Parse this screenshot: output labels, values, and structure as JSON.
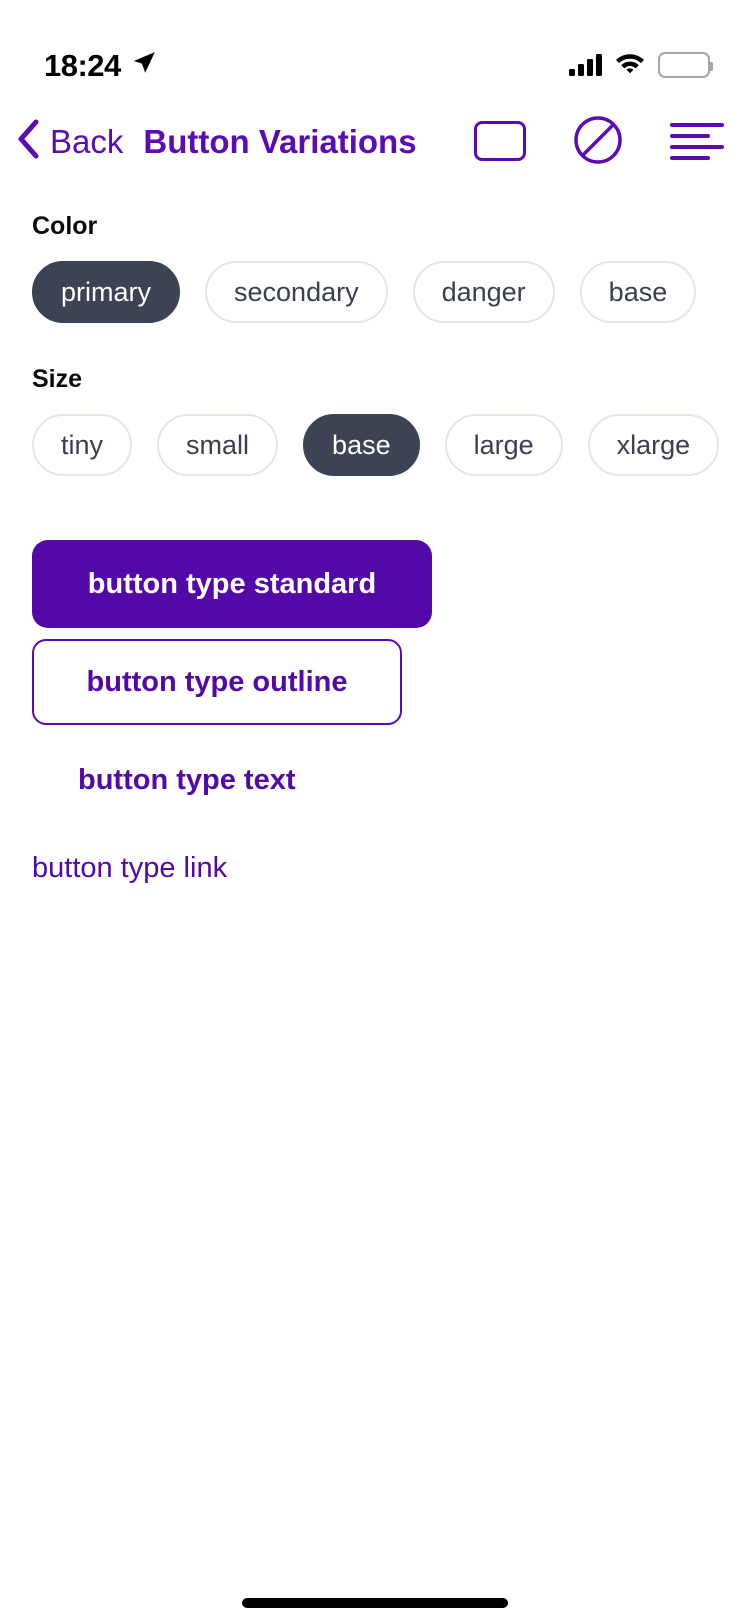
{
  "status_bar": {
    "time": "18:24",
    "location_icon": "location-arrow-icon",
    "signal_icon": "cellular-signal-icon",
    "wifi_icon": "wifi-icon",
    "battery_icon": "battery-full-icon"
  },
  "nav_bar": {
    "back_label": "Back",
    "back_icon": "chevron-left-icon",
    "title": "Button Variations",
    "actions": [
      {
        "name": "rounded-square-icon"
      },
      {
        "name": "prohibited-circle-slash-icon"
      },
      {
        "name": "list-lines-icon"
      }
    ]
  },
  "sections": {
    "color": {
      "label": "Color",
      "options": [
        {
          "label": "primary",
          "selected": true
        },
        {
          "label": "secondary",
          "selected": false
        },
        {
          "label": "danger",
          "selected": false
        },
        {
          "label": "base",
          "selected": false
        }
      ]
    },
    "size": {
      "label": "Size",
      "options": [
        {
          "label": "tiny",
          "selected": false
        },
        {
          "label": "small",
          "selected": false
        },
        {
          "label": "base",
          "selected": true
        },
        {
          "label": "large",
          "selected": false
        },
        {
          "label": "xlarge",
          "selected": false
        }
      ]
    }
  },
  "demo_buttons": {
    "standard": "button type standard",
    "outline": "button type outline",
    "text": "button type text",
    "link": "button type link"
  },
  "colors": {
    "brand_purple": "#5209A8",
    "nav_purple": "#5B0BB5",
    "chip_selected": "#3C4355",
    "chip_border": "#E2E5EC",
    "chip_text": "#39404F",
    "label_text": "#0B0B0B",
    "background": "#FFFFFF"
  }
}
